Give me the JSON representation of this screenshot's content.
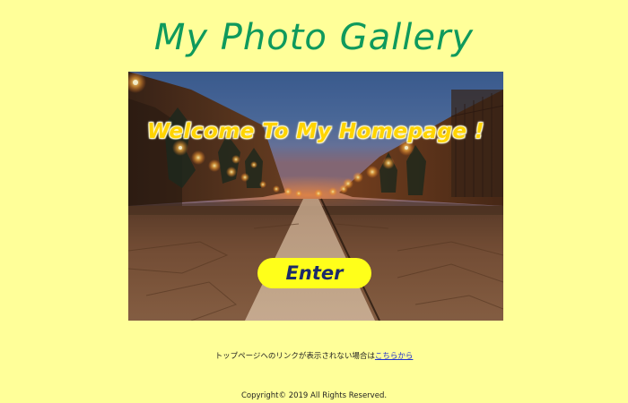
{
  "page": {
    "title": "My Photo Gallery",
    "background_color": "#ffff99",
    "title_color": "#0f9a5c"
  },
  "hero": {
    "welcome_text": "Welcome To My Homepage !",
    "enter_label": "Enter",
    "welcome_color": "#ffd400",
    "button_color": "#ffff1a",
    "button_text_color": "#1b2a6a"
  },
  "footer": {
    "notice_text": "トップページへのリンクが表示されない場合は",
    "notice_link": "こちらから",
    "copyright": "Copyright© 2019 All Rights Reserved."
  }
}
